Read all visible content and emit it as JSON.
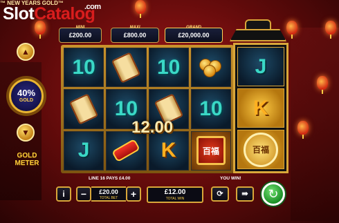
{
  "header": {
    "logo_part1": "Slot",
    "logo_part2": "Catalog",
    "logo_suffix": ".com",
    "game_title": "™ NEW YEARS GOLD™"
  },
  "jackpots": {
    "mini": {
      "label": "MINI",
      "value": "£200.00"
    },
    "maxi": {
      "label": "MAXI",
      "value": "£800.00"
    },
    "grand": {
      "label": "GRAND",
      "value": "£20,000.00"
    }
  },
  "gold_meter": {
    "percent": "40%",
    "unit": "GOLD",
    "label": "GOLD METER",
    "level": 0.4
  },
  "reels": {
    "rows": [
      [
        "10",
        "scroll",
        "10",
        "coins"
      ],
      [
        "scroll",
        "10",
        "scroll",
        "10"
      ],
      [
        "J",
        "firecracker",
        "K",
        "seal"
      ]
    ],
    "gold_column": [
      "J",
      "K",
      "seal"
    ],
    "seal_text": "百福",
    "win_amount": "12.00"
  },
  "panel": {
    "info_line": "LINE 16 PAYS £4.00",
    "you_win": "YOU WIN!",
    "info_button": "i",
    "minus_button": "−",
    "plus_button": "+",
    "total_bet_value": "£20.00",
    "total_bet_label": "TOTAL BET",
    "total_win_value": "£12.00",
    "total_win_label": "TOTAL WIN",
    "autoplay_icon": "autoplay-icon",
    "turbo_icon": "turbo-icon",
    "spin_icon": "spin-icon"
  },
  "colors": {
    "background": "#8a1414",
    "gold": "#d9a73a",
    "spin": "#2bb33a",
    "symbol_teal": "#3ad8c6"
  }
}
